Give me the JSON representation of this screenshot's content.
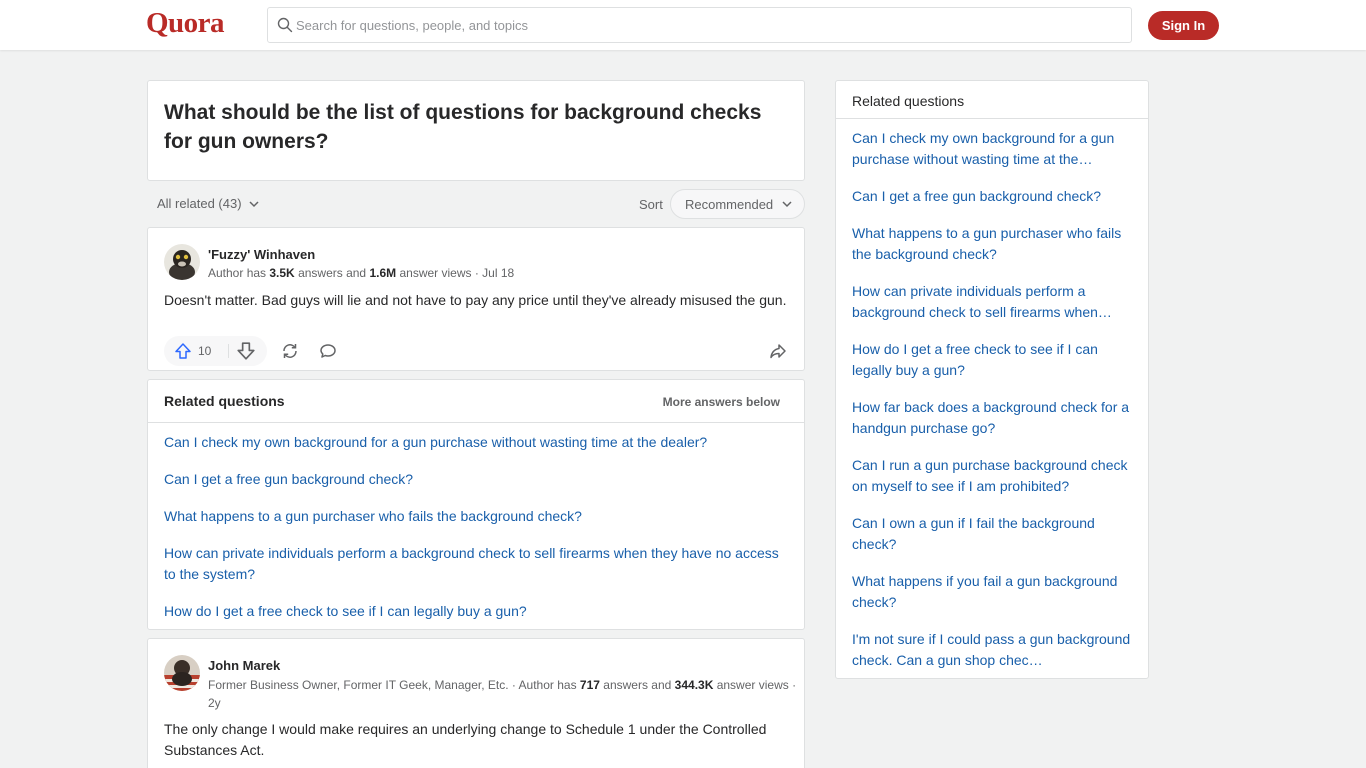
{
  "header": {
    "logo": "Quora",
    "search_placeholder": "Search for questions, people, and topics",
    "signin_label": "Sign In"
  },
  "question": {
    "title": "What should be the list of questions for background checks for gun owners?"
  },
  "filters": {
    "all_related": "All related (43)",
    "sort_label": "Sort",
    "sort_value": "Recommended"
  },
  "answers": [
    {
      "author": "'Fuzzy' Winhaven",
      "meta_prefix": "Author has ",
      "answers_count": "3.5K",
      "meta_mid": " answers and ",
      "views_count": "1.6M",
      "meta_suffix": " answer views · Jul 18",
      "text": "Doesn't matter. Bad guys will lie and not have to pay any price until they've already misused the gun.",
      "upvotes": "10"
    },
    {
      "author": "John Marek",
      "credential": "Former Business Owner, Former IT Geek, Manager, Etc. · Author has ",
      "answers_count": "717",
      "meta_mid": " answers and ",
      "views_count": "344.3K",
      "meta_suffix": " answer views · 2y",
      "text": "The only change I would make requires an underlying change to Schedule 1 under the Controlled Substances Act."
    }
  ],
  "feed_related": {
    "heading": "Related questions",
    "more_label": "More answers below",
    "items": [
      "Can I check my own background for a gun purchase without wasting time at the dealer?",
      "Can I get a free gun background check?",
      "What happens to a gun purchaser who fails the background check?",
      "How can private individuals perform a background check to sell firearms when they have no access to the system?",
      "How do I get a free check to see if I can legally buy a gun?"
    ]
  },
  "sidebar": {
    "heading": "Related questions",
    "items": [
      "Can I check my own background for a gun purchase without wasting time at the…",
      "Can I get a free gun background check?",
      "What happens to a gun purchaser who fails the background check?",
      "How can private individuals perform a background check to sell firearms when…",
      "How do I get a free check to see if I can legally buy a gun?",
      "How far back does a background check for a handgun purchase go?",
      "Can I run a gun purchase background check on myself to see if I am prohibited?",
      "Can I own a gun if I fail the background check?",
      "What happens if you fail a gun background check?",
      "I'm not sure if I could pass a gun background check. Can a gun shop chec…"
    ]
  },
  "colors": {
    "brand": "#b92b27",
    "link": "#195faa",
    "upvote": "#2e69ff"
  }
}
